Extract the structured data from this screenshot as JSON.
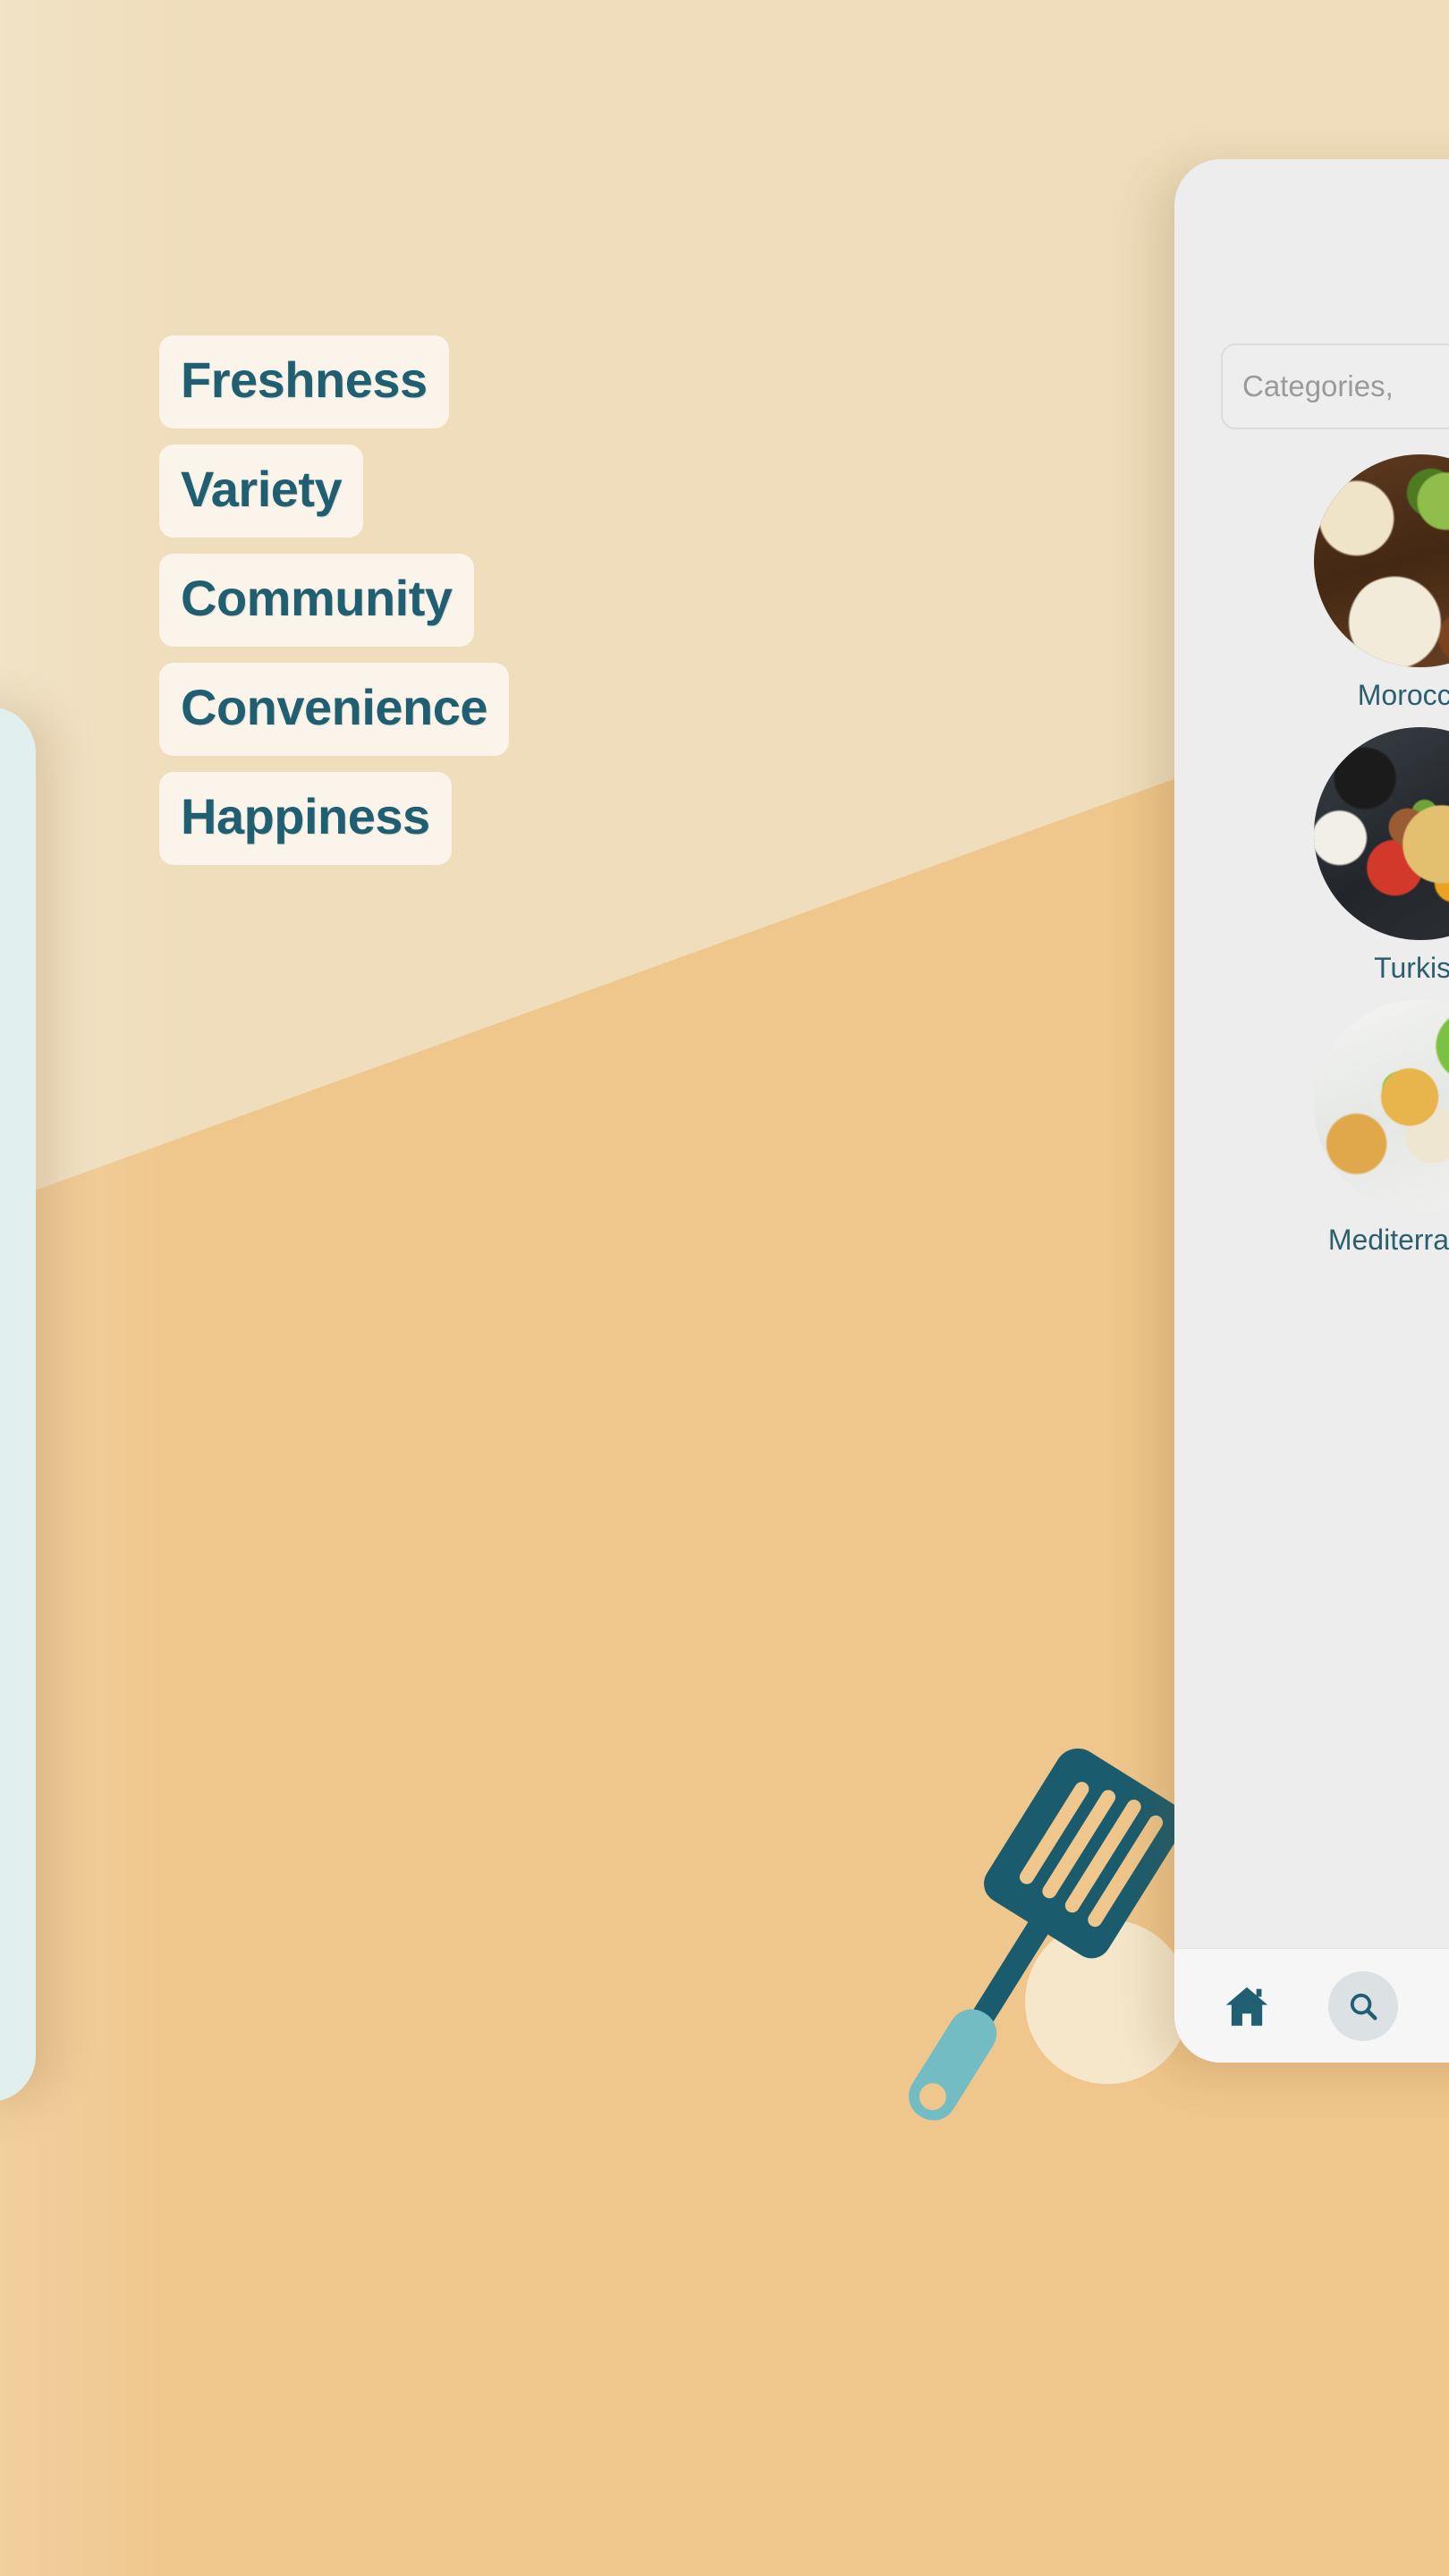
{
  "palette": {
    "bg_light": "#EFDDBB",
    "bg_dark": "#EFC68B",
    "teal": "#1F5F71",
    "tag_bg": "#FAF4EB",
    "panel_bg": "#EDEDEE",
    "left_card_bg": "#E2EFEF",
    "handle_teal": "#74BCC4"
  },
  "features": {
    "tags": [
      {
        "label": "Freshness"
      },
      {
        "label": "Variety"
      },
      {
        "label": "Community"
      },
      {
        "label": "Convenience"
      },
      {
        "label": "Happiness"
      }
    ]
  },
  "left_card": {
    "button_label": ""
  },
  "illustration": {
    "name": "spatula-illustration"
  },
  "phone": {
    "search": {
      "placeholder": "Categories,",
      "value": ""
    },
    "categories": [
      {
        "label": "Moroccan",
        "image": "moroccan-food-photo"
      },
      {
        "label": "Turkish",
        "image": "turkish-food-photo"
      },
      {
        "label": "Mediterranean",
        "image": "mediterranean-food-photo"
      }
    ],
    "bottom_nav": [
      {
        "icon": "home-icon",
        "label": ""
      },
      {
        "icon": "search-icon",
        "label": ""
      }
    ]
  }
}
